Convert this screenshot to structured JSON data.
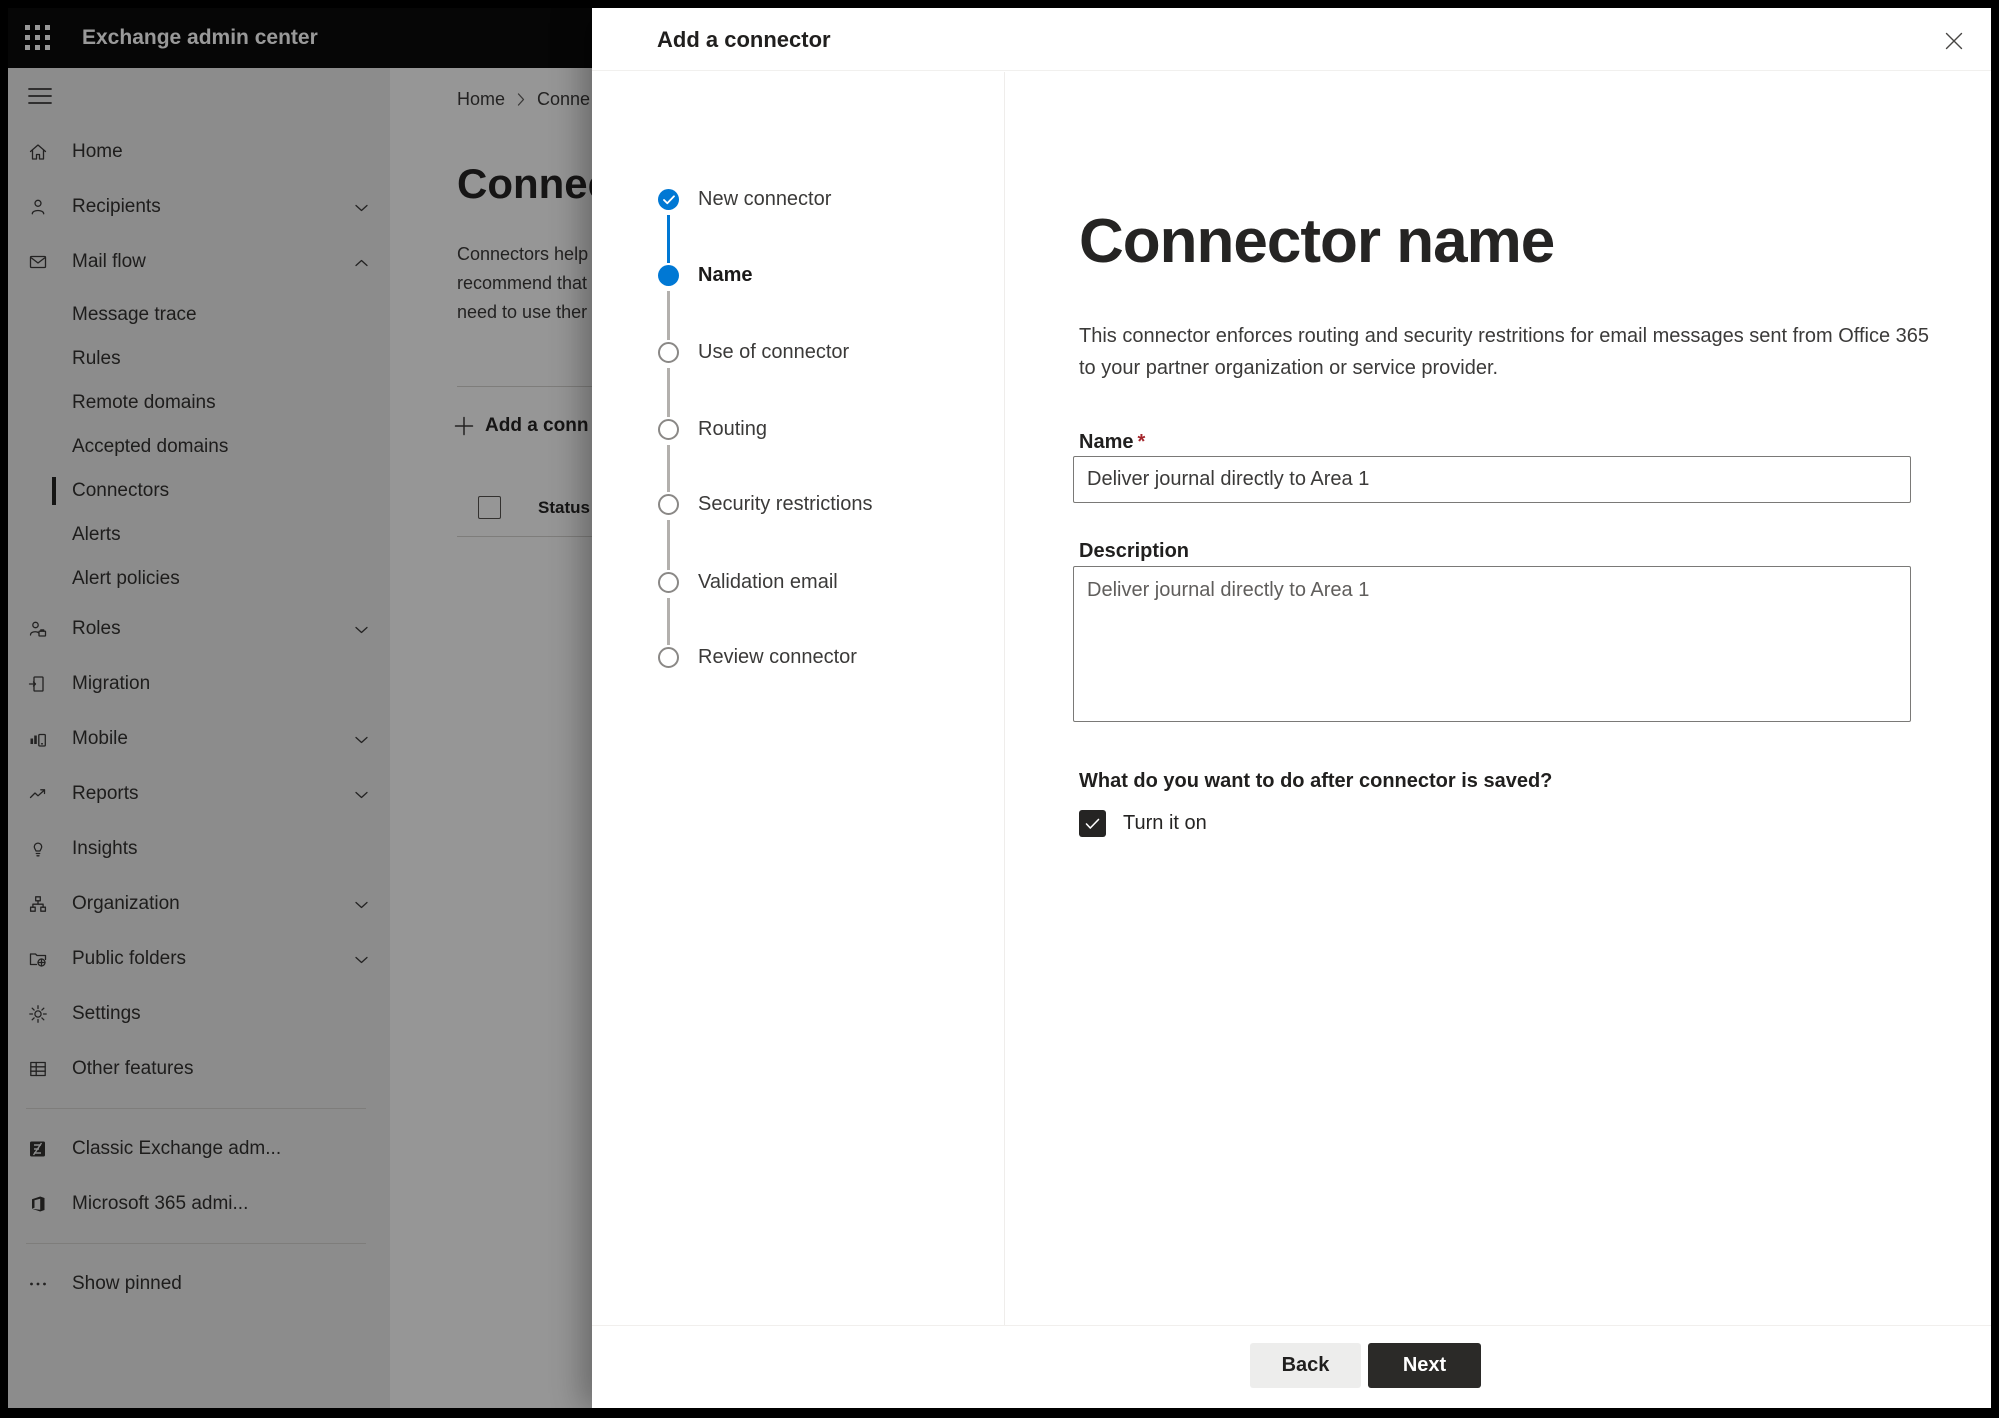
{
  "topbar": {
    "title": "Exchange admin center"
  },
  "sidebar": {
    "items": [
      {
        "label": "Home",
        "icon": "home-icon"
      },
      {
        "label": "Recipients",
        "icon": "person-icon",
        "chevron": "down"
      },
      {
        "label": "Mail flow",
        "icon": "mail-icon",
        "chevron": "up"
      },
      {
        "label": "Message trace",
        "sub": true
      },
      {
        "label": "Rules",
        "sub": true
      },
      {
        "label": "Remote domains",
        "sub": true
      },
      {
        "label": "Accepted domains",
        "sub": true
      },
      {
        "label": "Connectors",
        "sub": true,
        "selected": true
      },
      {
        "label": "Alerts",
        "sub": true
      },
      {
        "label": "Alert policies",
        "sub": true
      },
      {
        "label": "Roles",
        "icon": "roles-icon",
        "chevron": "down"
      },
      {
        "label": "Migration",
        "icon": "migration-icon"
      },
      {
        "label": "Mobile",
        "icon": "mobile-icon",
        "chevron": "down"
      },
      {
        "label": "Reports",
        "icon": "reports-icon",
        "chevron": "down"
      },
      {
        "label": "Insights",
        "icon": "lightbulb-icon"
      },
      {
        "label": "Organization",
        "icon": "org-chart-icon",
        "chevron": "down"
      },
      {
        "label": "Public folders",
        "icon": "public-folder-icon",
        "chevron": "down"
      },
      {
        "label": "Settings",
        "icon": "gear-icon"
      },
      {
        "label": "Other features",
        "icon": "table-icon"
      }
    ],
    "footer_items": [
      {
        "label": "Classic Exchange adm...",
        "icon": "exchange-logo-icon"
      },
      {
        "label": "Microsoft 365 admi...",
        "icon": "office-logo-icon"
      }
    ],
    "show_pinned": "Show pinned"
  },
  "background": {
    "breadcrumb": {
      "home": "Home",
      "current": "Conne"
    },
    "heading": "Connec",
    "description_lines": [
      "Connectors help",
      "recommend that",
      "need to use ther"
    ],
    "add_button": "Add a conn",
    "table": {
      "status_header": "Status"
    }
  },
  "modal": {
    "title": "Add a connector",
    "steps": [
      {
        "label": "New connector",
        "state": "done"
      },
      {
        "label": "Name",
        "state": "current"
      },
      {
        "label": "Use of connector",
        "state": "upcoming"
      },
      {
        "label": "Routing",
        "state": "upcoming"
      },
      {
        "label": "Security restrictions",
        "state": "upcoming"
      },
      {
        "label": "Validation email",
        "state": "upcoming"
      },
      {
        "label": "Review connector",
        "state": "upcoming"
      }
    ],
    "content": {
      "heading": "Connector name",
      "description_lines": [
        "This connector enforces routing and security restritions for email messages sent from Office 365",
        "to your partner organization or service provider."
      ],
      "name_label": "Name",
      "required_mark": "*",
      "name_value": "Deliver journal directly to Area 1",
      "description_label": "Description",
      "description_value": "Deliver journal directly to Area 1",
      "after_save_question": "What do you want to do after connector is saved?",
      "turn_on_label": "Turn it on"
    },
    "footer": {
      "back": "Back",
      "next": "Next"
    },
    "colors": {
      "accent": "#0078d4",
      "required": "#a4262c",
      "next_button_bg": "#2b2a28"
    }
  }
}
